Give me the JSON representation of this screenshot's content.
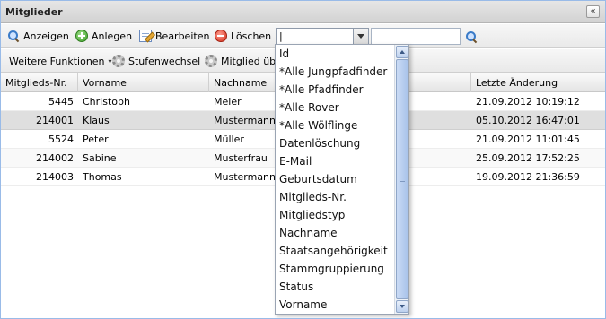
{
  "window": {
    "title": "Mitglieder",
    "collapse_glyph": "«"
  },
  "toolbar": {
    "anzeigen": "Anzeigen",
    "anlegen": "Anlegen",
    "bearbeiten": "Bearbeiten",
    "loeschen": "Löschen",
    "filter_value": "|",
    "search_value": ""
  },
  "toolbar2": {
    "weitere_funktionen": "Weitere Funktionen",
    "weitere_arrow": "▾",
    "stufenwechsel": "Stufenwechsel",
    "mitglied_ueber": "Mitglied über"
  },
  "grid": {
    "columns": [
      "Mitglieds-Nr.",
      "Vorname",
      "Nachname",
      "",
      "Letzte Änderung"
    ],
    "rows": [
      {
        "nr": "5445",
        "vorname": "Christoph",
        "nachname": "Meier",
        "geaendert": "21.09.2012 10:19:12"
      },
      {
        "nr": "214001",
        "vorname": "Klaus",
        "nachname": "Mustermann",
        "geaendert": "05.10.2012 16:47:01"
      },
      {
        "nr": "5524",
        "vorname": "Peter",
        "nachname": "Müller",
        "geaendert": "21.09.2012 11:01:45"
      },
      {
        "nr": "214002",
        "vorname": "Sabine",
        "nachname": "Musterfrau",
        "geaendert": "25.09.2012 17:52:25"
      },
      {
        "nr": "214003",
        "vorname": "Thomas",
        "nachname": "Mustermann",
        "geaendert": "19.09.2012 21:36:59"
      }
    ],
    "selected_row": 1
  },
  "dropdown": {
    "options": [
      "Id",
      "*Alle Jungpfadfinder",
      "*Alle Pfadfinder",
      "*Alle Rover",
      "*Alle Wölflinge",
      "Datenlöschung",
      "E-Mail",
      "Geburtsdatum",
      "Mitglieds-Nr.",
      "Mitgliedstyp",
      "Nachname",
      "Staatsangehörigkeit",
      "Stammgruppierung",
      "Status",
      "Vorname"
    ]
  },
  "icons": {
    "anzeigen": "search-icon",
    "anlegen": "add-icon",
    "bearbeiten": "edit-icon",
    "loeschen": "delete-icon",
    "stufenwechsel": "gear-icon",
    "mitglied_ueber": "gear-icon",
    "search_button": "search-icon"
  },
  "colors": {
    "panel_border": "#99bbe8",
    "selected_row": "#dfdfdf",
    "scroll_thumb": "#a9c3ea"
  }
}
